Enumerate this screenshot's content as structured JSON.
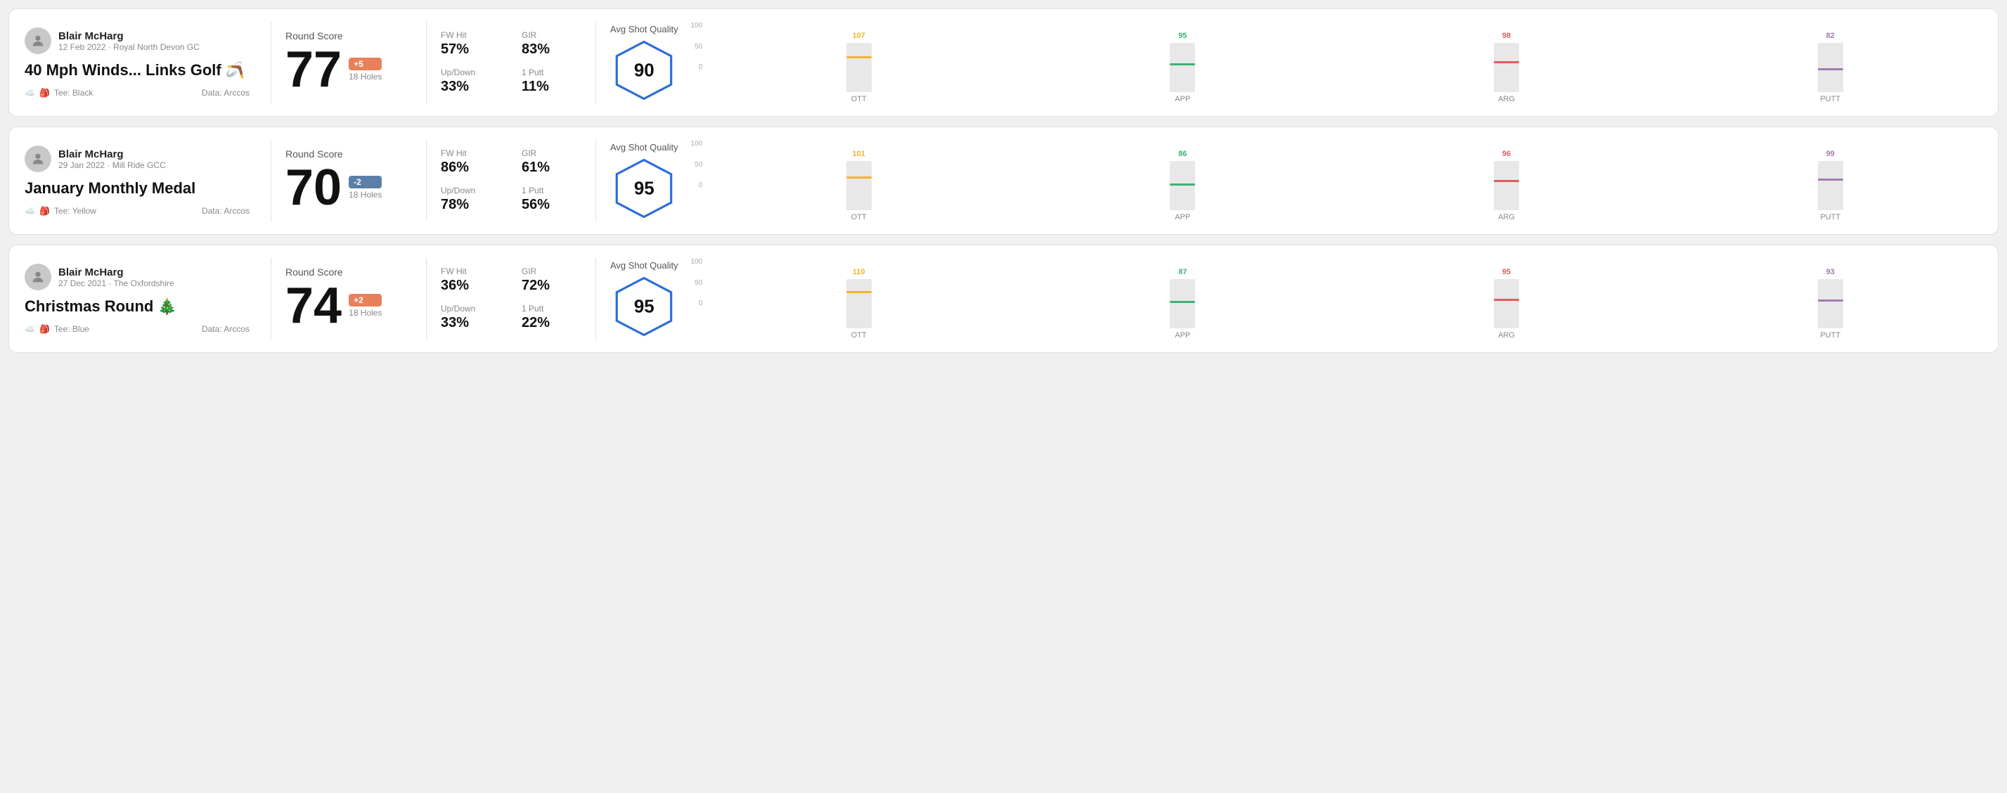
{
  "rounds": [
    {
      "id": "round-1",
      "player_name": "Blair McHarg",
      "date": "12 Feb 2022 · Royal North Devon GC",
      "title": "40 Mph Winds... Links Golf",
      "title_emoji": "🪃",
      "tee": "Black",
      "data_source": "Data: Arccos",
      "round_score_label": "Round Score",
      "score": "77",
      "score_diff": "+5",
      "score_diff_type": "positive",
      "holes": "18 Holes",
      "fw_hit_label": "FW Hit",
      "fw_hit_value": "57%",
      "gir_label": "GIR",
      "gir_value": "83%",
      "updown_label": "Up/Down",
      "updown_value": "33%",
      "one_putt_label": "1 Putt",
      "one_putt_value": "11%",
      "avg_shot_quality_label": "Avg Shot Quality",
      "hex_score": "90",
      "chart": {
        "y_labels": [
          "100",
          "50",
          "0"
        ],
        "columns": [
          {
            "label": "OTT",
            "value": 107,
            "color": "#f0b429",
            "bar_pct": 68
          },
          {
            "label": "APP",
            "value": 95,
            "color": "#3cb371",
            "bar_pct": 55
          },
          {
            "label": "ARG",
            "value": 98,
            "color": "#e05c5c",
            "bar_pct": 58
          },
          {
            "label": "PUTT",
            "value": 82,
            "color": "#a07cb0",
            "bar_pct": 45
          }
        ]
      }
    },
    {
      "id": "round-2",
      "player_name": "Blair McHarg",
      "date": "29 Jan 2022 · Mill Ride GCC",
      "title": "January Monthly Medal",
      "title_emoji": "",
      "tee": "Yellow",
      "data_source": "Data: Arccos",
      "round_score_label": "Round Score",
      "score": "70",
      "score_diff": "-2",
      "score_diff_type": "negative",
      "holes": "18 Holes",
      "fw_hit_label": "FW Hit",
      "fw_hit_value": "86%",
      "gir_label": "GIR",
      "gir_value": "61%",
      "updown_label": "Up/Down",
      "updown_value": "78%",
      "one_putt_label": "1 Putt",
      "one_putt_value": "56%",
      "avg_shot_quality_label": "Avg Shot Quality",
      "hex_score": "95",
      "chart": {
        "y_labels": [
          "100",
          "50",
          "0"
        ],
        "columns": [
          {
            "label": "OTT",
            "value": 101,
            "color": "#f0b429",
            "bar_pct": 64
          },
          {
            "label": "APP",
            "value": 86,
            "color": "#3cb371",
            "bar_pct": 50
          },
          {
            "label": "ARG",
            "value": 96,
            "color": "#e05c5c",
            "bar_pct": 57
          },
          {
            "label": "PUTT",
            "value": 99,
            "color": "#a07cb0",
            "bar_pct": 60
          }
        ]
      }
    },
    {
      "id": "round-3",
      "player_name": "Blair McHarg",
      "date": "27 Dec 2021 · The Oxfordshire",
      "title": "Christmas Round",
      "title_emoji": "🎄",
      "tee": "Blue",
      "data_source": "Data: Arccos",
      "round_score_label": "Round Score",
      "score": "74",
      "score_diff": "+2",
      "score_diff_type": "positive",
      "holes": "18 Holes",
      "fw_hit_label": "FW Hit",
      "fw_hit_value": "36%",
      "gir_label": "GIR",
      "gir_value": "72%",
      "updown_label": "Up/Down",
      "updown_value": "33%",
      "one_putt_label": "1 Putt",
      "one_putt_value": "22%",
      "avg_shot_quality_label": "Avg Shot Quality",
      "hex_score": "95",
      "chart": {
        "y_labels": [
          "100",
          "50",
          "0"
        ],
        "columns": [
          {
            "label": "OTT",
            "value": 110,
            "color": "#f0b429",
            "bar_pct": 72
          },
          {
            "label": "APP",
            "value": 87,
            "color": "#3cb371",
            "bar_pct": 51
          },
          {
            "label": "ARG",
            "value": 95,
            "color": "#e05c5c",
            "bar_pct": 56
          },
          {
            "label": "PUTT",
            "value": 93,
            "color": "#a07cb0",
            "bar_pct": 55
          }
        ]
      }
    }
  ]
}
